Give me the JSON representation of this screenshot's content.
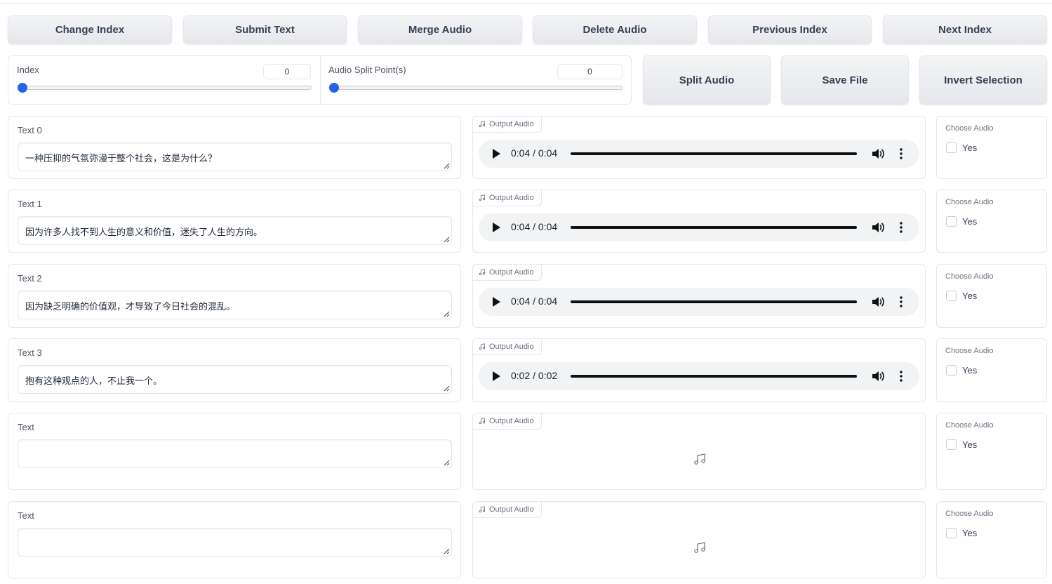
{
  "toolbar": {
    "buttons": [
      "Change Index",
      "Submit Text",
      "Merge Audio",
      "Delete Audio",
      "Previous Index",
      "Next Index"
    ]
  },
  "sliders": {
    "index": {
      "label": "Index",
      "value": "0"
    },
    "split": {
      "label": "Audio Split Point(s)",
      "value": "0"
    }
  },
  "actions": [
    "Split Audio",
    "Save File",
    "Invert Selection"
  ],
  "rows": [
    {
      "text_label": "Text 0",
      "text": "一种压抑的气氛弥漫于整个社会，这是为什么？",
      "audio_label": "Output Audio",
      "time": "0:04 / 0:04",
      "choose_label": "Choose Audio",
      "option": "Yes"
    },
    {
      "text_label": "Text 1",
      "text": "因为许多人找不到人生的意义和价值，迷失了人生的方向。",
      "audio_label": "Output Audio",
      "time": "0:04 / 0:04",
      "choose_label": "Choose Audio",
      "option": "Yes"
    },
    {
      "text_label": "Text 2",
      "text": "因为缺乏明确的价值观，才导致了今日社会的混乱。",
      "audio_label": "Output Audio",
      "time": "0:04 / 0:04",
      "choose_label": "Choose Audio",
      "option": "Yes"
    },
    {
      "text_label": "Text 3",
      "text": "抱有这种观点的人，不止我一个。",
      "audio_label": "Output Audio",
      "time": "0:02 / 0:02",
      "choose_label": "Choose Audio",
      "option": "Yes"
    },
    {
      "text_label": "Text",
      "text": "",
      "audio_label": "Output Audio",
      "time": "",
      "choose_label": "Choose Audio",
      "option": "Yes"
    },
    {
      "text_label": "Text",
      "text": "",
      "audio_label": "Output Audio",
      "time": "",
      "choose_label": "Choose Audio",
      "option": "Yes"
    }
  ],
  "icons": {
    "audio_label": "music-note-icon",
    "play": "play-icon",
    "volume": "volume-icon",
    "menu": "more-vertical-icon",
    "empty": "music-note-icon"
  },
  "colors": {
    "slider_accent": "#2563eb",
    "button_bg": "#e5e7eb",
    "border": "#e5e7eb"
  }
}
